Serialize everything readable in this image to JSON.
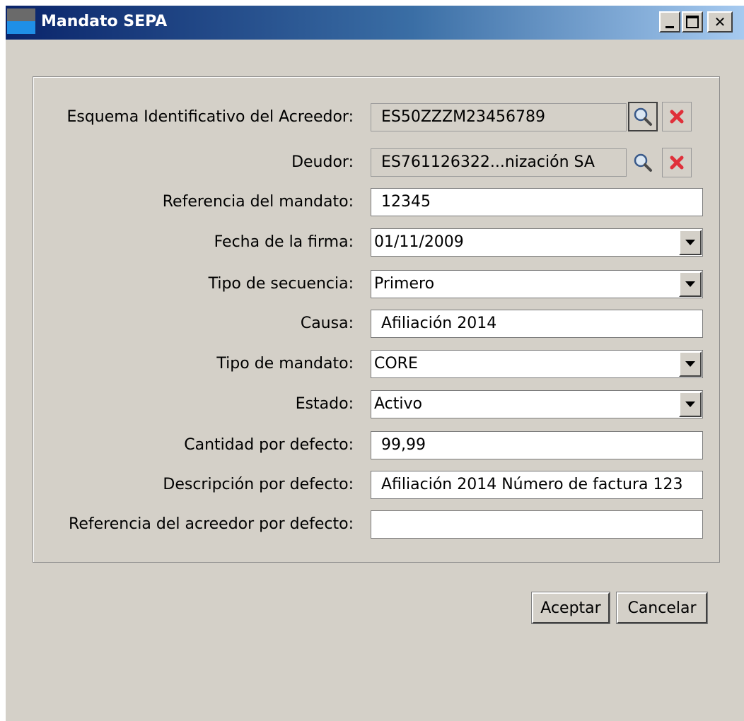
{
  "window": {
    "title": "Mandato SEPA"
  },
  "form": {
    "rows": [
      {
        "label": "Esquema Identificativo del Acreedor:",
        "value": "ES50ZZZM23456789",
        "kind": "lookup"
      },
      {
        "label": "Deudor:",
        "value": "ES761126322...nización SA",
        "kind": "lookup"
      },
      {
        "label": "Referencia del mandato:",
        "value": "12345",
        "kind": "text"
      },
      {
        "label": "Fecha de la firma:",
        "value": "01/11/2009",
        "kind": "combo"
      },
      {
        "label": "Tipo de secuencia:",
        "value": "Primero",
        "kind": "combo"
      },
      {
        "label": "Causa:",
        "value": "Afiliación 2014",
        "kind": "text"
      },
      {
        "label": "Tipo de mandato:",
        "value": "CORE",
        "kind": "combo"
      },
      {
        "label": "Estado:",
        "value": "Activo",
        "kind": "combo"
      },
      {
        "label": "Cantidad por defecto:",
        "value": "99,99",
        "kind": "text"
      },
      {
        "label": "Descripción por defecto:",
        "value": "Afiliación 2014 Número de factura 123",
        "kind": "text"
      },
      {
        "label": "Referencia del acreedor por defecto:",
        "value": "",
        "kind": "text"
      }
    ]
  },
  "buttons": {
    "accept": "Aceptar",
    "cancel": "Cancelar"
  },
  "icons": {
    "search": "magnifier-icon",
    "clear": "red-x-icon"
  }
}
